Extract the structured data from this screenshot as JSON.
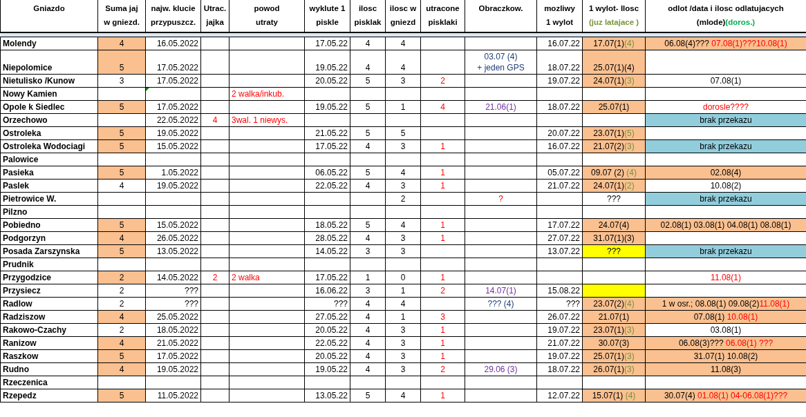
{
  "columns": [
    {
      "lines": [
        "Gniazdo"
      ]
    },
    {
      "lines": [
        "Suma jaj",
        "w gniezd."
      ]
    },
    {
      "lines": [
        "najw. klucie",
        "przypuszcz."
      ]
    },
    {
      "lines": [
        "Utrac.",
        "jajka"
      ]
    },
    {
      "lines": [
        "powod",
        "utraty"
      ]
    },
    {
      "lines": [
        "wyklute 1",
        "piskle"
      ]
    },
    {
      "lines": [
        "ilosc",
        "pisklak"
      ]
    },
    {
      "lines": [
        "ilosc w",
        "gniezd"
      ]
    },
    {
      "lines": [
        "utracone",
        "pisklaki"
      ]
    },
    {
      "lines": [
        "Obraczkow."
      ]
    },
    {
      "lines": [
        "mozliwy",
        "1 wylot"
      ]
    },
    {
      "lines": [
        "1 wylot- Ilosc",
        {
          "parts": [
            {
              "text": "(juz latajace )",
              "color": "#77933c"
            }
          ]
        }
      ]
    },
    {
      "lines": [
        "odlot /data i ilosc odlatujacych",
        {
          "parts": [
            {
              "text": "(mlode)"
            },
            {
              "text": "(doros.)",
              "color": "#00b050"
            }
          ]
        }
      ]
    }
  ],
  "rows": [
    {
      "name": "Molendy",
      "cells": [
        {
          "text": "4",
          "fill": {
            "color": "#fac090"
          }
        },
        "16.05.2022",
        null,
        null,
        "17.05.22",
        "4",
        "4",
        null,
        null,
        "16.07.22",
        {
          "parts": [
            {
              "text": "17.07(1)"
            },
            {
              "text": "(4)",
              "color": "#77933c"
            }
          ],
          "fill": {
            "color": "#fac090"
          }
        },
        {
          "parts": [
            {
              "text": "06.08(4)??? "
            },
            {
              "text": "07.08(1)???10.08(1)",
              "color": "#ff0000"
            }
          ],
          "fill": {
            "color": "#fac090"
          }
        }
      ]
    },
    {
      "name": "Niepolomice",
      "cells": [
        {
          "text": "5",
          "fill": {
            "color": "#fac090"
          }
        },
        "17.05.2022",
        null,
        null,
        "19.05.22",
        "4",
        "4",
        null,
        {
          "text": "03.07 (4)\n+ jeden GPS",
          "color": "#1f3d7a"
        },
        "18.07.22",
        {
          "text": "25.07(1)(4)",
          "fill": {
            "color": "#fac090"
          }
        },
        null
      ]
    },
    {
      "name": "Nietulisko /Kunow",
      "cells": [
        "3",
        "17.05.2022",
        null,
        null,
        "20.05.22",
        "5",
        "3",
        {
          "text": "2",
          "color": "#ff0000"
        },
        null,
        "19.07.22",
        {
          "parts": [
            {
              "text": "24.07(1)"
            },
            {
              "text": "(3)",
              "color": "#77933c"
            }
          ],
          "fill": {
            "color": "#fac090"
          }
        },
        "07.08(1)"
      ]
    },
    {
      "name": "Nowy Kamien",
      "cells": [
        null,
        {
          "marked": true
        },
        null,
        {
          "text": "2 walka/inkub.",
          "color": "#ff0000"
        },
        null,
        null,
        null,
        null,
        null,
        null,
        null,
        null
      ]
    },
    {
      "name": "Opole k Siedlec",
      "cells": [
        {
          "text": "5",
          "fill": {
            "color": "#fac090"
          }
        },
        "17.05.2022",
        null,
        null,
        "19.05.22",
        "5",
        "1",
        {
          "text": "4",
          "color": "#ff0000"
        },
        {
          "text": "21.06(1)",
          "color": "#7030a0"
        },
        "18.07.22",
        {
          "text": "25.07(1)",
          "fill": {
            "color": "#fac090"
          }
        },
        {
          "text": "dorosle????",
          "color": "#ff0000"
        }
      ]
    },
    {
      "name": "Orzechowo",
      "cells": [
        null,
        "22.05.2022",
        {
          "text": "4",
          "color": "#ff0000"
        },
        {
          "text": "3wal. 1 niewys.",
          "color": "#ff0000"
        },
        null,
        null,
        null,
        null,
        null,
        null,
        null,
        {
          "text": "brak przekazu",
          "fill": {
            "color": "#92cddc"
          }
        }
      ]
    },
    {
      "name": "Ostroleka",
      "cells": [
        {
          "text": "5",
          "fill": {
            "color": "#fac090"
          }
        },
        "19.05.2022",
        null,
        null,
        "21.05.22",
        "5",
        "5",
        null,
        null,
        "20.07.22",
        {
          "parts": [
            {
              "text": "23.07(1)"
            },
            {
              "text": "(5)",
              "color": "#77933c"
            }
          ],
          "fill": {
            "color": "#fac090"
          }
        },
        null
      ]
    },
    {
      "name": "Ostroleka Wodociagi",
      "cells": [
        {
          "text": "5",
          "fill": {
            "color": "#fac090"
          }
        },
        "15.05.2022",
        null,
        null,
        "17.05.22",
        "4",
        "3",
        {
          "text": "1",
          "color": "#ff0000"
        },
        null,
        "16.07.22",
        {
          "parts": [
            {
              "text": "21.07(2)"
            },
            {
              "text": "(3)",
              "color": "#77933c"
            }
          ],
          "fill": {
            "color": "#fac090"
          }
        },
        {
          "text": "brak przekazu",
          "fill": {
            "color": "#92cddc"
          }
        }
      ]
    },
    {
      "name": "Palowice",
      "cells": [
        null,
        null,
        null,
        null,
        null,
        null,
        null,
        null,
        null,
        null,
        null,
        null
      ]
    },
    {
      "name": "Pasieka",
      "cells": [
        {
          "text": "5",
          "fill": {
            "color": "#fac090"
          }
        },
        "1.05.2022",
        null,
        null,
        "06.05.22",
        "5",
        "4",
        {
          "text": "1",
          "color": "#ff0000"
        },
        null,
        "05.07.22",
        {
          "parts": [
            {
              "text": "09.07 (2) "
            },
            {
              "text": "(4)",
              "color": "#77933c"
            }
          ],
          "fill": {
            "color": "#fac090"
          }
        },
        {
          "text": "02.08(4)",
          "fill": {
            "color": "#fac090"
          }
        }
      ]
    },
    {
      "name": "Paslek",
      "cells": [
        "4",
        "19.05.2022",
        null,
        null,
        "22.05.22",
        "4",
        "3",
        {
          "text": "1",
          "color": "#ff0000"
        },
        null,
        "21.07.22",
        {
          "parts": [
            {
              "text": "24.07(1)"
            },
            {
              "text": "(2)",
              "color": "#77933c"
            }
          ],
          "fill": {
            "color": "#fac090"
          }
        },
        "10.08(2)"
      ]
    },
    {
      "name": "Pietrowice W.",
      "cells": [
        null,
        null,
        null,
        null,
        null,
        null,
        "2",
        null,
        {
          "text": "?",
          "color": "#ff0000"
        },
        null,
        "???",
        {
          "text": "brak przekazu",
          "fill": {
            "color": "#92cddc"
          }
        }
      ]
    },
    {
      "name": "Pilzno",
      "cells": [
        null,
        null,
        null,
        null,
        null,
        null,
        null,
        null,
        null,
        null,
        null,
        null
      ]
    },
    {
      "name": "Pobiedno",
      "cells": [
        {
          "text": "5",
          "fill": {
            "color": "#fac090"
          }
        },
        "15.05.2022",
        null,
        null,
        "18.05.22",
        "5",
        "4",
        {
          "text": "1",
          "color": "#ff0000"
        },
        null,
        "17.07.22",
        {
          "text": "24.07(4)",
          "fill": {
            "color": "#fac090"
          }
        },
        {
          "text": "02.08(1) 03.08(1) 04.08(1) 08.08(1)",
          "fill": {
            "color": "#fac090"
          }
        }
      ]
    },
    {
      "name": "Podgorzyn",
      "cells": [
        {
          "text": "4",
          "fill": {
            "color": "#fac090"
          }
        },
        "26.05.2022",
        null,
        null,
        "28.05.22",
        "4",
        "3",
        {
          "text": "1",
          "color": "#ff0000"
        },
        null,
        "27.07.22",
        {
          "text": "31.07(1)(3)",
          "fill": {
            "color": "#fac090"
          }
        },
        null
      ]
    },
    {
      "name": "Posada Zarszynska",
      "cells": [
        {
          "text": "5",
          "fill": {
            "color": "#fac090"
          }
        },
        "13.05.2022",
        null,
        null,
        "14.05.22",
        "3",
        "3",
        null,
        null,
        "13.07.22",
        {
          "text": "???",
          "fill": {
            "color": "#ffff00"
          }
        },
        {
          "text": "brak przekazu",
          "fill": {
            "color": "#92cddc"
          }
        }
      ]
    },
    {
      "name": "Prudnik",
      "cells": [
        null,
        null,
        null,
        null,
        null,
        null,
        null,
        null,
        null,
        null,
        null,
        null
      ]
    },
    {
      "name": "Przygodzice",
      "cells": [
        {
          "text": "2",
          "fill": {
            "color": "#fac090"
          }
        },
        "14.05.2022",
        {
          "text": "2",
          "color": "#ff0000"
        },
        {
          "text": "2 walka",
          "color": "#ff0000"
        },
        "17.05.22",
        "1",
        "0",
        {
          "text": "1",
          "color": "#ff0000"
        },
        null,
        null,
        null,
        {
          "text": "11.08(1)",
          "color": "#ff0000"
        }
      ]
    },
    {
      "name": "Przysiecz",
      "cells": [
        "2",
        "???",
        null,
        null,
        "16.06.22",
        "3",
        "1",
        {
          "text": "2",
          "color": "#ff0000"
        },
        {
          "text": "14.07(1)",
          "color": "#7030a0"
        },
        "15.08.22",
        {
          "fill": {
            "color": "#ffff00"
          }
        },
        null
      ]
    },
    {
      "name": "Radlow",
      "cells": [
        "2",
        "???",
        null,
        null,
        "???",
        "4",
        "4",
        null,
        {
          "text": "??? (4)",
          "color": "#1f3d7a"
        },
        "???",
        {
          "parts": [
            {
              "text": "23.07(2)"
            },
            {
              "text": "(4)",
              "color": "#77933c"
            }
          ],
          "fill": {
            "color": "#fac090"
          }
        },
        {
          "parts": [
            {
              "text": "1 w osr.; 08.08(1) 09.08(2)"
            },
            {
              "text": "11.08(1)",
              "color": "#ff0000"
            }
          ],
          "fill": {
            "color": "#fac090"
          }
        }
      ]
    },
    {
      "name": "Radziszow",
      "cells": [
        {
          "text": "4",
          "fill": {
            "color": "#fac090"
          }
        },
        "25.05.2022",
        null,
        null,
        "27.05.22",
        "4",
        "1",
        {
          "text": "3",
          "color": "#ff0000"
        },
        null,
        "26.07.22",
        {
          "text": "21.07(1)",
          "fill": {
            "color": "#fac090"
          }
        },
        {
          "parts": [
            {
              "text": "07.08(1) "
            },
            {
              "text": "10.08(1)",
              "color": "#ff0000"
            }
          ],
          "fill": {
            "color": "#fac090"
          }
        }
      ]
    },
    {
      "name": "Rakowo-Czachy",
      "cells": [
        "2",
        "18.05.2022",
        null,
        null,
        "20.05.22",
        "4",
        "3",
        {
          "text": "1",
          "color": "#ff0000"
        },
        null,
        "19.07.22",
        {
          "parts": [
            {
              "text": "23.07(1)"
            },
            {
              "text": "(3)",
              "color": "#77933c"
            }
          ],
          "fill": {
            "color": "#fac090"
          }
        },
        "03.08(1)"
      ]
    },
    {
      "name": "Ranizow",
      "cells": [
        {
          "text": "4",
          "fill": {
            "color": "#fac090"
          }
        },
        "21.05.2022",
        null,
        null,
        "22.05.22",
        "4",
        "3",
        {
          "text": "1",
          "color": "#ff0000"
        },
        null,
        "21.07.22",
        {
          "text": "30.07(3)",
          "fill": {
            "color": "#fac090"
          }
        },
        {
          "parts": [
            {
              "text": "06.08(3)??? "
            },
            {
              "text": "06.08(1) ???",
              "color": "#ff0000"
            }
          ],
          "fill": {
            "color": "#fac090"
          }
        }
      ]
    },
    {
      "name": "Raszkow",
      "cells": [
        {
          "text": "5",
          "fill": {
            "color": "#fac090"
          }
        },
        "17.05.2022",
        null,
        null,
        "20.05.22",
        "4",
        "3",
        {
          "text": "1",
          "color": "#ff0000"
        },
        null,
        "19.07.22",
        {
          "parts": [
            {
              "text": "25.07(1)"
            },
            {
              "text": "(3)",
              "color": "#77933c"
            }
          ],
          "fill": {
            "color": "#fac090"
          }
        },
        {
          "text": "31.07(1) 10.08(2)",
          "fill": {
            "color": "#fac090"
          }
        }
      ]
    },
    {
      "name": "Rudno",
      "cells": [
        {
          "text": "4",
          "fill": {
            "color": "#fac090"
          }
        },
        "19.05.2022",
        null,
        null,
        "19.05.22",
        "4",
        "3",
        {
          "text": "2",
          "color": "#ff0000"
        },
        {
          "text": "29.06 (3)",
          "color": "#7030a0"
        },
        "18.07.22",
        {
          "parts": [
            {
              "text": "26.07(1)"
            },
            {
              "text": "(3)",
              "color": "#77933c"
            }
          ],
          "fill": {
            "color": "#fac090"
          }
        },
        {
          "text": "11.08(3)",
          "fill": {
            "color": "#fac090"
          }
        }
      ]
    },
    {
      "name": "Rzeczenica",
      "cells": [
        null,
        null,
        null,
        null,
        null,
        null,
        null,
        null,
        null,
        null,
        null,
        null
      ]
    },
    {
      "name": "Rzepedz",
      "cells": [
        {
          "text": "5",
          "fill": {
            "color": "#fac090"
          }
        },
        "11.05.2022",
        null,
        null,
        "13.05.22",
        "5",
        "4",
        {
          "text": "1",
          "color": "#ff0000"
        },
        null,
        "12.07.22",
        {
          "parts": [
            {
              "text": "15.07(1) "
            },
            {
              "text": "(4)",
              "color": "#77933c"
            }
          ],
          "fill": {
            "color": "#fac090"
          }
        },
        {
          "parts": [
            {
              "text": "30.07(4) "
            },
            {
              "text": "01.08(1)  04-06.08(1)???",
              "color": "#ff0000"
            }
          ],
          "fill": {
            "color": "#fac090"
          }
        }
      ]
    }
  ]
}
